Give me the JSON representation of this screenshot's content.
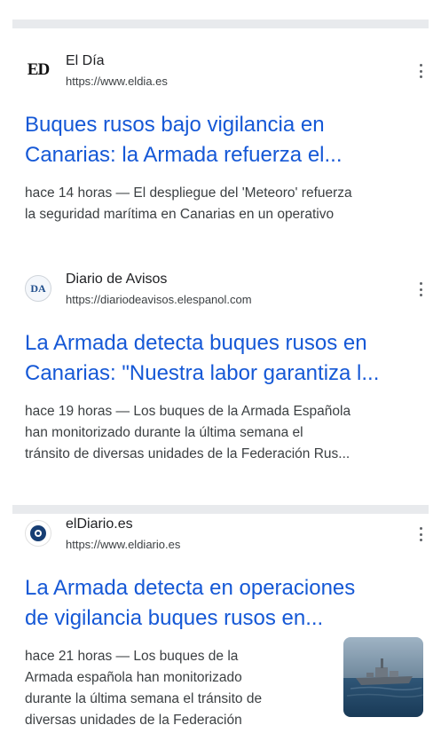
{
  "results": [
    {
      "source_name": "El Día",
      "source_url": "https://www.eldia.es",
      "favicon_text": "ED",
      "headline_lines": [
        "Buques rusos bajo vigilancia en",
        "Canarias: la Armada refuerza el..."
      ],
      "snippet_lines": [
        "hace 14 horas — El despliegue del 'Meteoro' refuerza",
        "la seguridad marítima en Canarias en un operativo"
      ]
    },
    {
      "source_name": "Diario de Avisos",
      "source_url": "https://diariodeavisos.elespanol.com",
      "favicon_text": "DA",
      "headline_lines": [
        "La Armada detecta buques rusos en",
        "Canarias: \"Nuestra labor garantiza l..."
      ],
      "snippet_lines": [
        "hace 19 horas — Los buques de la Armada Española",
        "han monitorizado durante la última semana el",
        "tránsito de diversas unidades de la Federación Rus..."
      ]
    },
    {
      "source_name": "elDiario.es",
      "source_url": "https://www.eldiario.es",
      "headline_lines": [
        "La Armada detecta en operaciones",
        "de vigilancia buques rusos en..."
      ],
      "snippet_lines": [
        "hace 21 horas — Los buques de la",
        "Armada española han monitorizado",
        "durante la última semana el tránsito de",
        "diversas unidades de la Federación"
      ]
    }
  ],
  "colors": {
    "headline": "#1558d6",
    "snippet": "#3c4043",
    "divider": "#e8eaed"
  },
  "icons": {
    "more": "more-vert-icon",
    "thumbnail": "warship-thumbnail"
  }
}
